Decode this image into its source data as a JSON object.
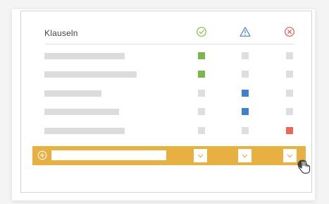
{
  "header": {
    "title": "Klauseln",
    "columns": [
      {
        "icon": "check-circle-icon",
        "color": "#7cc049"
      },
      {
        "icon": "warning-triangle-icon",
        "color": "#3a7bd5"
      },
      {
        "icon": "x-circle-icon",
        "color": "#e05a4a"
      }
    ]
  },
  "colors": {
    "accent": "#e8b040",
    "approved": "#7ab648",
    "warning": "#3d80d4",
    "rejected": "#e8685a",
    "neutral": "#dedede"
  },
  "rows": [
    {
      "status": [
        "approved",
        "neutral",
        "neutral"
      ]
    },
    {
      "status": [
        "approved",
        "neutral",
        "neutral"
      ]
    },
    {
      "status": [
        "neutral",
        "warning",
        "neutral"
      ]
    },
    {
      "status": [
        "neutral",
        "warning",
        "neutral"
      ]
    },
    {
      "status": [
        "neutral",
        "neutral",
        "rejected"
      ]
    }
  ],
  "add_row": {
    "input_value": "",
    "placeholder": "",
    "dropdowns": [
      "approved-column-select",
      "warning-column-select",
      "rejected-column-select"
    ]
  }
}
